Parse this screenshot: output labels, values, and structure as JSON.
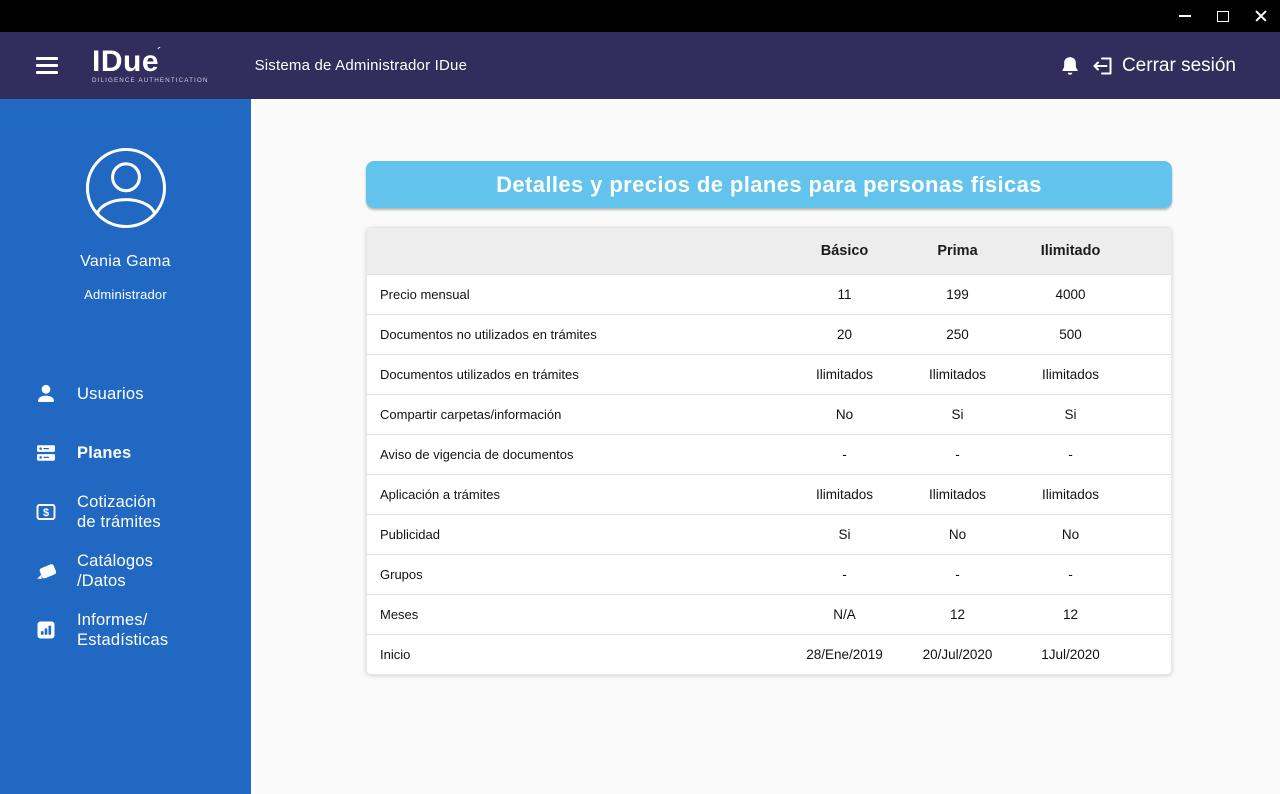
{
  "colors": {
    "titlebar": "#000000",
    "navbar": "#312d5c",
    "sidebar": "#2168c2",
    "banner": "#62c4ec",
    "table_header_bg": "#ededed",
    "page_bg": "#fafafa"
  },
  "titlebar": {
    "icons": [
      "minimize-icon",
      "maximize-icon",
      "close-icon"
    ]
  },
  "header": {
    "brand": {
      "name": "IDue",
      "mark": "´",
      "tagline": "DILIGENCE AUTHENTICATION"
    },
    "app_title": "Sistema de Administrador IDue",
    "icons": [
      "menu-icon",
      "bell-icon",
      "logout-icon"
    ],
    "logout_label": "Cerrar sesión"
  },
  "sidebar": {
    "user": {
      "name": "Vania Gama",
      "role": "Administrador"
    },
    "items": [
      {
        "icon": "users-icon",
        "active": false,
        "lines": [
          "Usuarios"
        ]
      },
      {
        "icon": "plans-icon",
        "active": true,
        "lines": [
          "Planes"
        ]
      },
      {
        "icon": "quote-icon",
        "active": false,
        "lines": [
          "Cotización",
          "de trámites"
        ]
      },
      {
        "icon": "catalogs-icon",
        "active": false,
        "lines": [
          "Catálogos",
          "/Datos"
        ]
      },
      {
        "icon": "reports-icon",
        "active": false,
        "lines": [
          "Informes/",
          "Estadísticas"
        ]
      }
    ]
  },
  "main": {
    "banner_title": "Detalles y precios de planes para personas físicas",
    "table": {
      "columns": [
        "Básico",
        "Prima",
        "Ilimitado"
      ],
      "rows": [
        {
          "label": "Precio mensual",
          "values": [
            "11",
            "199",
            "4000"
          ]
        },
        {
          "label": "Documentos no utilizados en trámites",
          "values": [
            "20",
            "250",
            "500"
          ]
        },
        {
          "label": "Documentos utilizados en trámites",
          "values": [
            "Ilimitados",
            "Ilimitados",
            "Ilimitados"
          ]
        },
        {
          "label": "Compartir carpetas/información",
          "values": [
            "No",
            "Si",
            "Si"
          ]
        },
        {
          "label": "Aviso de vigencia de documentos",
          "values": [
            "-",
            "-",
            "-"
          ]
        },
        {
          "label": "Aplicación a trámites",
          "values": [
            "Ilimitados",
            "Ilimitados",
            "Ilimitados"
          ]
        },
        {
          "label": "Publicidad",
          "values": [
            "Si",
            "No",
            "No"
          ]
        },
        {
          "label": "Grupos",
          "values": [
            "-",
            "-",
            "-"
          ]
        },
        {
          "label": "Meses",
          "values": [
            "N/A",
            "12",
            "12"
          ]
        },
        {
          "label": "Inicio",
          "values": [
            "28/Ene/2019",
            "20/Jul/2020",
            "1Jul/2020"
          ]
        }
      ]
    }
  }
}
